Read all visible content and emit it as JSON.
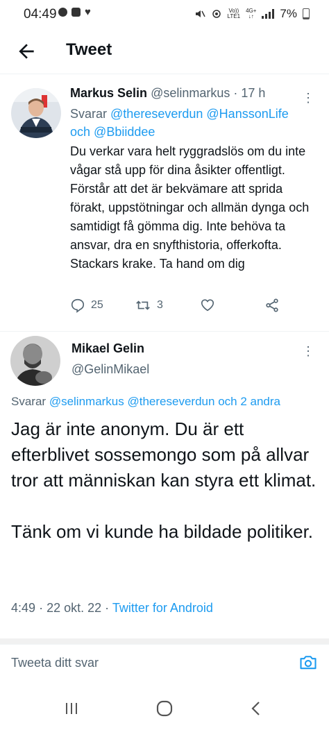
{
  "status_bar": {
    "time": "04:49",
    "network_top": "Vo))",
    "network_bottom": "LTE1",
    "network_type": "4G+",
    "battery": "7%"
  },
  "header": {
    "title": "Tweet"
  },
  "tweet1": {
    "name": "Markus Selin",
    "handle": "@selinmarkus",
    "separator": "·",
    "time": "17 h",
    "reply_prefix": "Svarar",
    "mention1": "@thereseverdun",
    "mention2": "@HanssonLife",
    "conj": "och",
    "mention3": "@Bbiiddee",
    "body": "Du verkar vara helt ryggradslös om du inte vågar stå upp för dina åsikter offentligt. Förstår att det är bekvämare att sprida förakt, uppstötningar och allmän dynga och samtidigt få gömma dig. Inte behöva ta ansvar, dra en snyfthistoria, offerkofta. Stackars krake. Ta hand om dig",
    "reply_count": "25",
    "retweet_count": "3"
  },
  "tweet2": {
    "name": "Mikael Gelin",
    "handle": "@GelinMikael",
    "reply_prefix": "Svarar",
    "mention1": "@selinmarkus",
    "mention2": "@thereseverdun",
    "conj": "och",
    "others": "2 andra",
    "body_p1": "Jag är inte anonym. Du är ett efterblivet sossemongo som på allvar tror att människan kan styra ett klimat.",
    "body_p2": "Tänk om vi kunde ha bildade politiker.",
    "time": "4:49",
    "date": "22 okt. 22",
    "separator": "·",
    "client": "Twitter for Android"
  },
  "reply_bar": {
    "placeholder": "Tweeta ditt svar"
  },
  "colors": {
    "accent": "#1d9bf0",
    "secondary_text": "#536471",
    "primary_text": "#0f1419"
  },
  "icons": [
    "back-arrow-icon",
    "more-icon",
    "reply-icon",
    "retweet-icon",
    "like-icon",
    "share-icon",
    "camera-icon",
    "recents-icon",
    "home-icon",
    "back-nav-icon"
  ]
}
